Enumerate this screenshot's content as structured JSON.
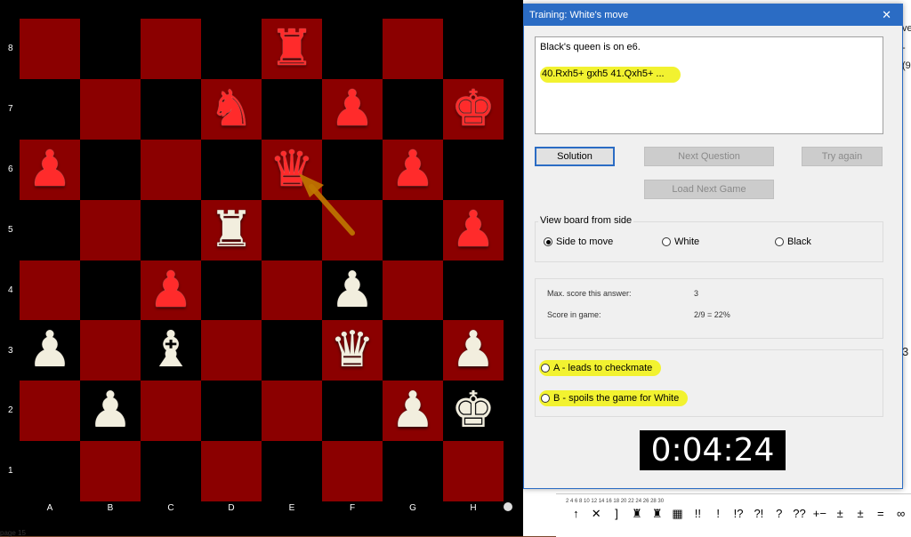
{
  "board": {
    "ranks": [
      "8",
      "7",
      "6",
      "5",
      "4",
      "3",
      "2",
      "1"
    ],
    "files": [
      "A",
      "B",
      "C",
      "D",
      "E",
      "F",
      "G",
      "H"
    ],
    "rows": [
      [
        "",
        "",
        "",
        "",
        "r",
        "",
        "",
        ""
      ],
      [
        "",
        "",
        "",
        "n",
        "",
        "p",
        "",
        "k"
      ],
      [
        "p",
        "",
        "",
        "",
        "q",
        "",
        "p",
        ""
      ],
      [
        "",
        "",
        "",
        "R",
        "",
        "",
        "",
        "p"
      ],
      [
        "",
        "",
        "p",
        "",
        "",
        "P",
        "",
        ""
      ],
      [
        "P",
        "",
        "B",
        "",
        "",
        "Q",
        "",
        "P"
      ],
      [
        "",
        "P",
        "",
        "",
        "",
        "",
        "P",
        "K"
      ],
      [
        "",
        "",
        "",
        "",
        "",
        "",
        "",
        ""
      ]
    ],
    "glyphs": {
      "k": "♚",
      "q": "♛",
      "r": "♜",
      "b": "♝",
      "n": "♞",
      "p": "♟"
    },
    "arrow": {
      "from_square": "f5",
      "to_square": "e6",
      "color": "#c07800"
    }
  },
  "dialog": {
    "title": "Training: White's move",
    "close_glyph": "✕",
    "question_line1": "Black's queen is on e6.",
    "question_line2": "40.Rxh5+ gxh5 41.Qxh5+ ...",
    "buttons": {
      "solution": "Solution",
      "next_question": "Next Question",
      "try_again": "Try again",
      "load_next_game": "Load Next Game"
    },
    "view_group": {
      "label": "View board from side",
      "options": [
        "Side to move",
        "White",
        "Black"
      ],
      "selected": "Side to move"
    },
    "score": {
      "max_label": "Max. score this answer:",
      "max_value": "3",
      "game_label": "Score in game:",
      "game_value": "2/9 = 22%"
    },
    "answers": {
      "a": "A - leads to checkmate",
      "b": "B - spoils the game for White"
    },
    "timer": "0:04:24",
    "highlight_color": "#f2f230"
  },
  "background": {
    "status_text": "page 15",
    "tick_labels": "2      4      6      8      10     12     14     16     18     20     22     24     26     28     30",
    "symbols": [
      "↑",
      "✕",
      "]",
      "♜",
      "♜",
      "▦",
      "!!",
      "!",
      "!?",
      "?!",
      "?",
      "??",
      "+−",
      "±",
      "±",
      "=",
      "∞"
    ],
    "edge_texts": [
      "ve",
      "-",
      "(9",
      "3"
    ]
  }
}
